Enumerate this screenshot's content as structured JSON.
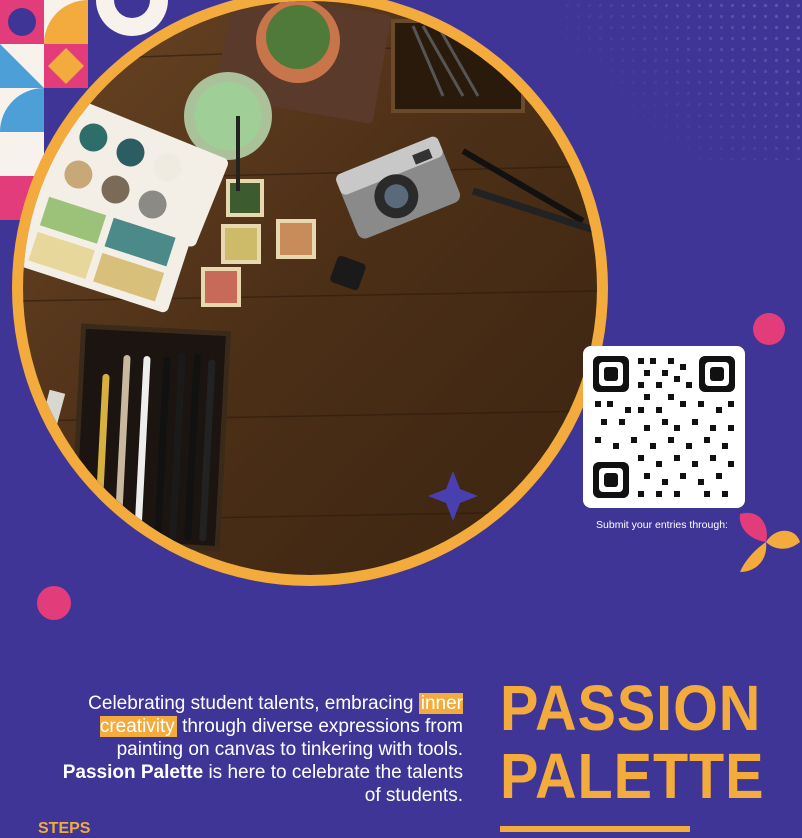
{
  "qr": {
    "caption": "Submit your entries through:"
  },
  "tagline": {
    "part1": "Celebrating student talents, embracing ",
    "highlight": "inner creativity",
    "part2": " through diverse expressions from  painting on canvas to tinkering with tools. ",
    "brand": "Passion Palette",
    "part3": " is here to celebrate the talents of students."
  },
  "title": {
    "line1": "PASSION",
    "line2": "PALETTE"
  },
  "steps_label": "STEPS",
  "colors": {
    "background": "#3f3596",
    "accent": "#f2ab3c",
    "pink": "#e33c7a"
  }
}
